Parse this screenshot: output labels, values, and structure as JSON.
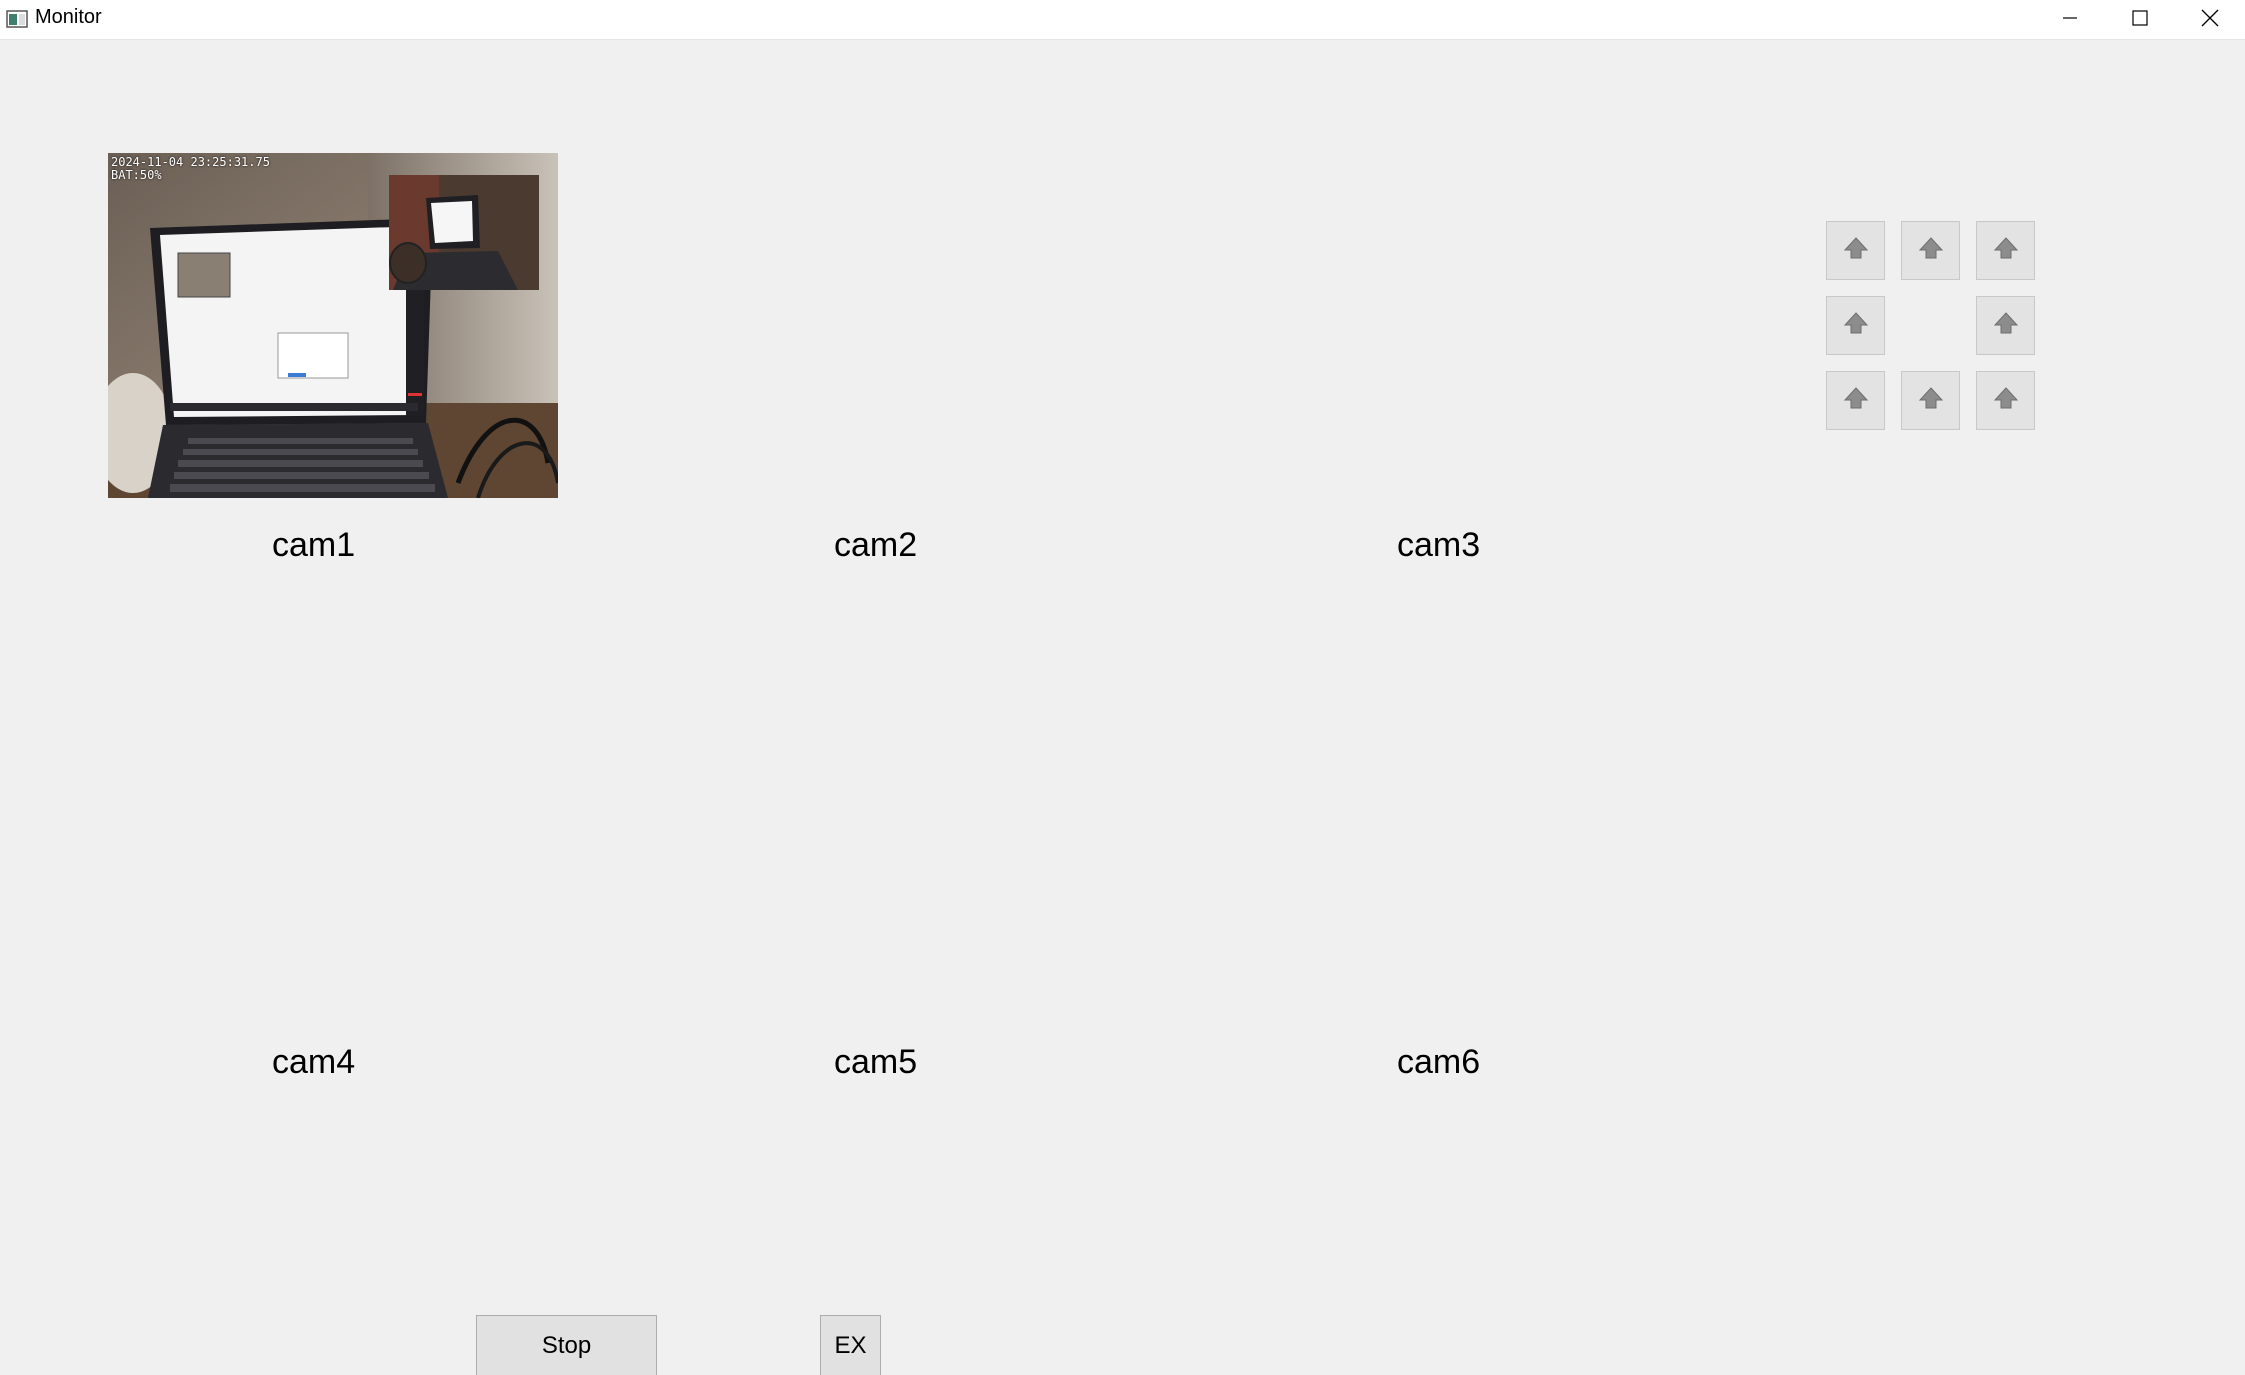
{
  "window": {
    "title": "Monitor",
    "icons": {
      "app": "app-window-icon",
      "minimize": "minimize-icon",
      "maximize": "maximize-icon",
      "close": "close-icon"
    }
  },
  "preview": {
    "osd_timestamp": "2024-11-04 23:25:31.75",
    "osd_battery": "BAT:50%"
  },
  "cameras": [
    {
      "label": "cam1"
    },
    {
      "label": "cam2"
    },
    {
      "label": "cam3"
    },
    {
      "label": "cam4"
    },
    {
      "label": "cam5"
    },
    {
      "label": "cam6"
    }
  ],
  "pad": {
    "icon": "up-arrow-icon",
    "buttons": [
      "top-left",
      "top-center",
      "top-right",
      "middle-left",
      "middle-right",
      "bottom-left",
      "bottom-center",
      "bottom-right"
    ]
  },
  "controls": {
    "stop_label": "Stop",
    "ex_label": "EX"
  },
  "colors": {
    "background": "#f0f0f0",
    "titlebar": "#ffffff",
    "button_face": "#e1e1e1",
    "pad_face": "#e3e3e3"
  }
}
